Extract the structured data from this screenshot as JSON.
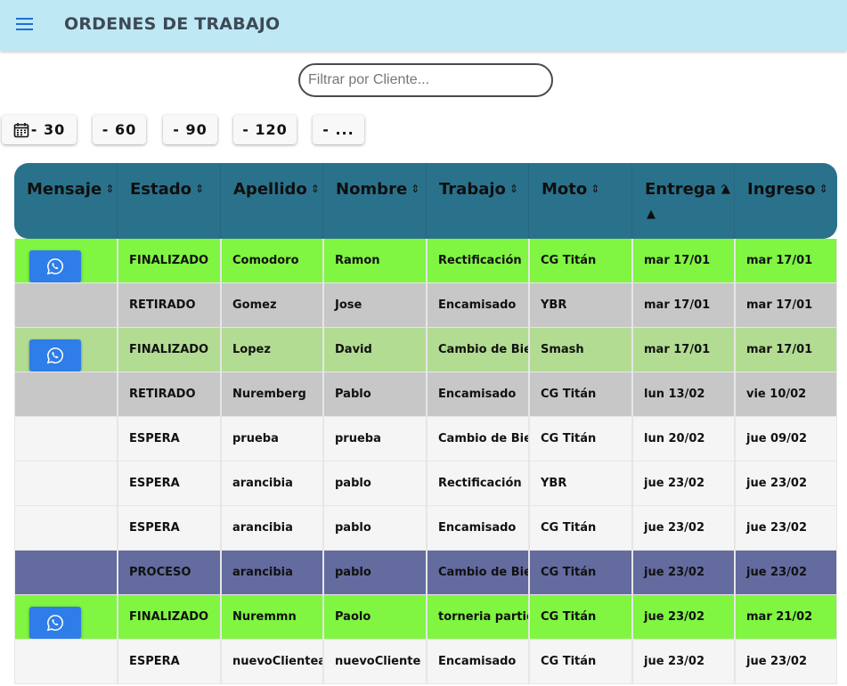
{
  "app": {
    "title": "ORDENES DE TRABAJO",
    "menu_icon": "hamburger-menu-icon"
  },
  "search": {
    "placeholder": "Filtrar por Cliente...",
    "value": ""
  },
  "filters": [
    {
      "label": "- 30",
      "icon": "calendar-icon"
    },
    {
      "label": "- 60"
    },
    {
      "label": "- 90"
    },
    {
      "label": "- 120"
    },
    {
      "label": "- ..."
    }
  ],
  "table": {
    "colors": {
      "header": "#2a728c",
      "finalizado": "#80f542",
      "finalizado_alt": "#b3dc93",
      "retirado": "#c7c7c7",
      "espera": "#f5f5f5",
      "proceso": "#636b9f",
      "whatsapp_button": "#2e7de9"
    },
    "columns": [
      {
        "label": "Mensaje",
        "sort": "⌃⌄"
      },
      {
        "label": "Estado",
        "sort": "⌃⌄"
      },
      {
        "label": "Apellido",
        "sort": "⌃⌄"
      },
      {
        "label": "Nombre",
        "sort": "⌃⌄"
      },
      {
        "label": "Trabajo",
        "sort": "⌃⌄"
      },
      {
        "label": "Moto",
        "sort": "⌃⌄"
      },
      {
        "label": "Entrega",
        "sort": "^"
      },
      {
        "label": "Ingreso",
        "sort": "⌃⌄"
      }
    ],
    "rows": [
      {
        "whatsapp": true,
        "estado": "FINALIZADO",
        "apellido": "Comodoro",
        "nombre": "Ramon",
        "trabajo": "Rectificación",
        "moto": "CG Titán",
        "entrega": "mar 17/01",
        "ingreso": "mar 17/01",
        "color": "#80f542"
      },
      {
        "whatsapp": false,
        "estado": "RETIRADO",
        "apellido": "Gomez",
        "nombre": "Jose",
        "trabajo": "Encamisado",
        "moto": "YBR",
        "entrega": "mar 17/01",
        "ingreso": "mar 17/01",
        "color": "#c7c7c7"
      },
      {
        "whatsapp": true,
        "estado": "FINALIZADO",
        "apellido": "Lopez",
        "nombre": "David",
        "trabajo": "Cambio de Biela",
        "moto": "Smash",
        "entrega": "mar 17/01",
        "ingreso": "mar 17/01",
        "color": "#b3dc93"
      },
      {
        "whatsapp": false,
        "estado": "RETIRADO",
        "apellido": "Nuremberg",
        "nombre": "Pablo",
        "trabajo": "Encamisado",
        "moto": "CG Titán",
        "entrega": "lun 13/02",
        "ingreso": "vie 10/02",
        "color": "#c7c7c7"
      },
      {
        "whatsapp": false,
        "estado": "ESPERA",
        "apellido": "prueba",
        "nombre": "prueba",
        "trabajo": "Cambio de Biela",
        "moto": "CG Titán",
        "entrega": "lun 20/02",
        "ingreso": "jue 09/02",
        "color": "#f5f5f5"
      },
      {
        "whatsapp": false,
        "estado": "ESPERA",
        "apellido": "arancibia",
        "nombre": "pablo",
        "trabajo": "Rectificación",
        "moto": "YBR",
        "entrega": "jue 23/02",
        "ingreso": "jue 23/02",
        "color": "#f5f5f5"
      },
      {
        "whatsapp": false,
        "estado": "ESPERA",
        "apellido": "arancibia",
        "nombre": "pablo",
        "trabajo": "Encamisado",
        "moto": "CG Titán",
        "entrega": "jue 23/02",
        "ingreso": "jue 23/02",
        "color": "#f5f5f5"
      },
      {
        "whatsapp": false,
        "estado": "PROCESO",
        "apellido": "arancibia",
        "nombre": "pablo",
        "trabajo": "Cambio de Biela",
        "moto": "CG Titán",
        "entrega": "jue 23/02",
        "ingreso": "jue 23/02",
        "color": "#636b9f"
      },
      {
        "whatsapp": true,
        "estado": "FINALIZADO",
        "apellido": "Nuremmn",
        "nombre": "Paolo",
        "trabajo": "torneria particular",
        "moto": "CG Titán",
        "entrega": "jue 23/02",
        "ingreso": "mar 21/02",
        "color": "#80f542"
      },
      {
        "whatsapp": false,
        "estado": "ESPERA",
        "apellido": "nuevoClienteap",
        "nombre": "nuevoCliente",
        "trabajo": "Encamisado",
        "moto": "CG Titán",
        "entrega": "jue 23/02",
        "ingreso": "jue 23/02",
        "color": "#f5f5f5"
      }
    ]
  }
}
